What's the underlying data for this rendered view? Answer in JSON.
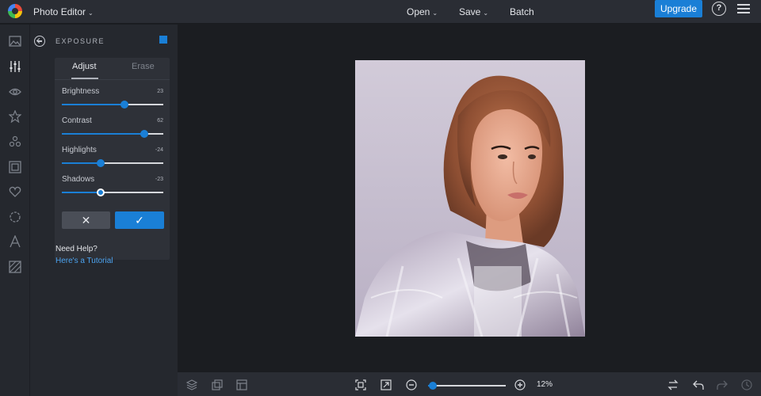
{
  "app": {
    "title": "Photo Editor"
  },
  "topbar": {
    "open_label": "Open",
    "save_label": "Save",
    "batch_label": "Batch",
    "upgrade_label": "Upgrade",
    "help_glyph": "?"
  },
  "rail": {
    "icons": [
      "image-icon",
      "sliders-icon",
      "eye-icon",
      "star-icon",
      "shapes-icon",
      "frame-icon",
      "heart-icon",
      "circle-icon",
      "text-icon",
      "texture-icon"
    ]
  },
  "panel": {
    "title": "EXPOSURE",
    "tabs": [
      {
        "label": "Adjust",
        "active": true
      },
      {
        "label": "Erase",
        "active": false
      }
    ],
    "sliders": [
      {
        "label": "Brightness",
        "value": 23,
        "display": "23"
      },
      {
        "label": "Contrast",
        "value": 62,
        "display": "62"
      },
      {
        "label": "Highlights",
        "value": -24,
        "display": "-24"
      },
      {
        "label": "Shadows",
        "value": -23,
        "display": "-23"
      }
    ],
    "slider_range": [
      -100,
      100
    ],
    "cancel_glyph": "✕",
    "ok_glyph": "✓",
    "help_title": "Need Help?",
    "help_link": "Here's a Tutorial"
  },
  "bottombar": {
    "zoom_percent": 12,
    "zoom_label": "12%",
    "zoom_fraction": 0.06
  },
  "colors": {
    "accent": "#1a7fd6",
    "link": "#4ca3ef",
    "background": "#1b1d21",
    "panel": "#25282e"
  }
}
